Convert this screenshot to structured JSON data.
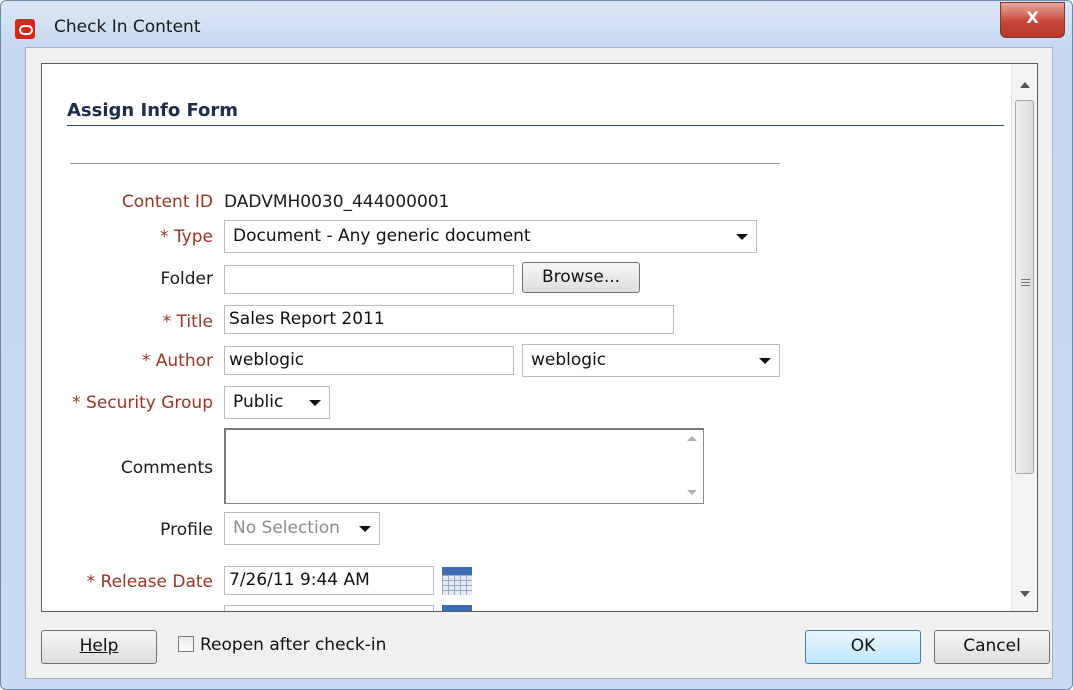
{
  "window": {
    "title": "Check In Content",
    "close_glyph": "X"
  },
  "form": {
    "header": "Assign Info Form",
    "content_id": {
      "label": "Content ID",
      "value": "DADVMH0030_444000001"
    },
    "type": {
      "label": "* Type",
      "value": "Document - Any generic document"
    },
    "folder": {
      "label": "Folder",
      "value": "",
      "browse_label": "Browse..."
    },
    "title": {
      "label": "* Title",
      "value": "Sales Report 2011"
    },
    "author": {
      "label": "* Author",
      "value": "weblogic",
      "select_value": "weblogic"
    },
    "security_group": {
      "label": "* Security Group",
      "value": "Public"
    },
    "comments": {
      "label": "Comments",
      "value": ""
    },
    "profile": {
      "label": "Profile",
      "value": "No Selection"
    },
    "release_date": {
      "label": "* Release Date",
      "value": "7/26/11 9:44 AM"
    }
  },
  "footer": {
    "help_label": "Help",
    "reopen": {
      "label": "Reopen after check-in",
      "checked": false
    },
    "ok_label": "OK",
    "cancel_label": "Cancel"
  },
  "colors": {
    "required_label": "#9b3326",
    "title_bar": "#c5d8ef",
    "close_button": "#c6473a"
  }
}
